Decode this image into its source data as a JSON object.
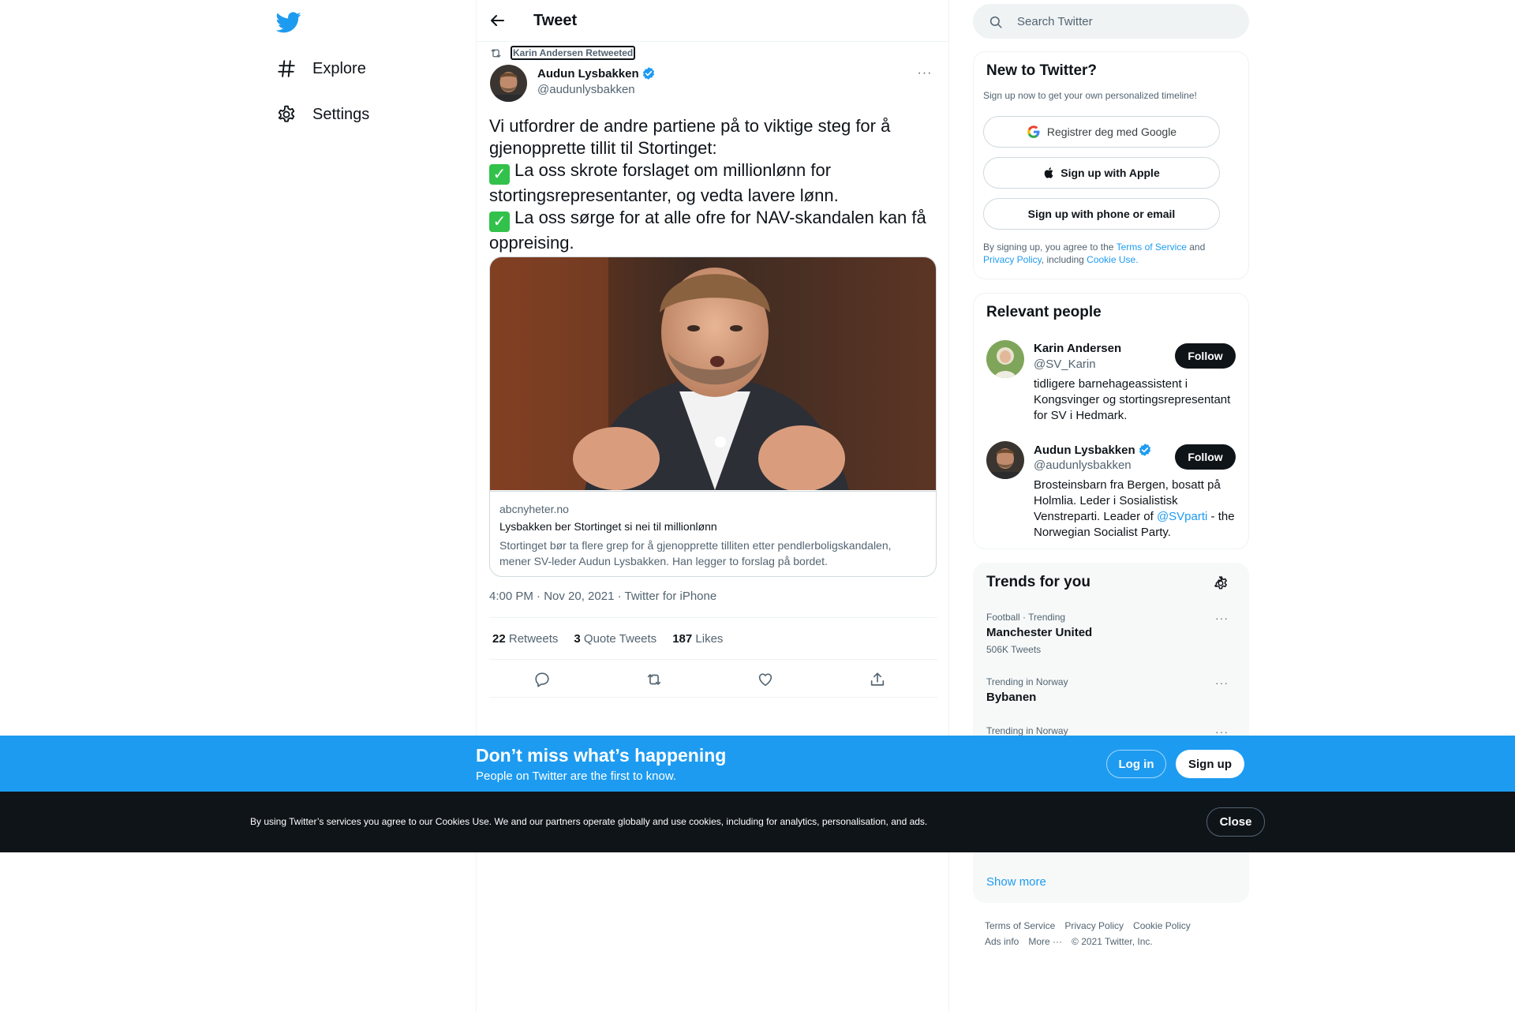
{
  "nav": {
    "logo": "twitter-bird-icon",
    "items": [
      {
        "label": "Explore",
        "icon": "hashtag-icon"
      },
      {
        "label": "Settings",
        "icon": "gear-icon"
      }
    ]
  },
  "header": {
    "title": "Tweet"
  },
  "tweet": {
    "retweeted_by": "Karin Andersen Retweeted",
    "author_name": "Audun Lysbakken",
    "author_handle": "@audunlysbakken",
    "text_line1": "Vi utfordrer de andre partiene på to viktige steg for å gjenopprette tillit til Stortinget:",
    "text_line2": "La oss skrote forslaget om millionlønn for stortingsrepresentanter, og vedta lavere lønn.",
    "text_line3": "La oss sørge for at alle ofre for NAV-skandalen kan få oppreising.",
    "check_glyph": "✓",
    "card": {
      "domain": "abcnyheter.no",
      "title": "Lysbakken ber Stortinget si nei til millionlønn",
      "description": "Stortinget bør ta flere grep for å gjenopprette tilliten etter pendlerboligskandalen, mener SV-leder Audun Lysbakken. Han legger to forslag på bordet."
    },
    "meta": "4:00 PM · Nov 20, 2021 · Twitter for iPhone",
    "stats": {
      "retweets_count": "22",
      "retweets_label": "Retweets",
      "quotes_count": "3",
      "quotes_label": "Quote Tweets",
      "likes_count": "187",
      "likes_label": "Likes"
    }
  },
  "search": {
    "placeholder": "Search Twitter"
  },
  "new_to_twitter": {
    "title": "New to Twitter?",
    "subtitle": "Sign up now to get your own personalized timeline!",
    "google_btn": "Registrer deg med Google",
    "apple_btn": "Sign up with Apple",
    "phone_btn": "Sign up with phone or email",
    "terms_prefix": "By signing up, you agree to the ",
    "terms_link": "Terms of Service",
    "terms_and": " and ",
    "privacy_link": "Privacy Policy",
    "terms_including": ", including ",
    "cookie_link": "Cookie Use."
  },
  "relevant_people": {
    "title": "Relevant people",
    "follow_label": "Follow",
    "people": [
      {
        "name": "Karin Andersen",
        "handle": "@SV_Karin",
        "bio": "tidligere barnehageassistent i Kongsvinger og stortingsrepresentant for SV i Hedmark."
      },
      {
        "name": "Audun Lysbakken",
        "handle": "@audunlysbakken",
        "bio_prefix": "Brosteinsbarn fra Bergen, bosatt på Holmlia. Leder i Sosialistisk Venstreparti. Leader of ",
        "bio_link": "@SVparti",
        "bio_suffix": " - the Norwegian Socialist Party."
      }
    ]
  },
  "trends": {
    "title": "Trends for you",
    "items": [
      {
        "context": "Football · Trending",
        "name": "Manchester United",
        "count": "506K Tweets"
      },
      {
        "context": "Trending in Norway",
        "name": "Bybanen"
      },
      {
        "context": "Trending in Norway"
      }
    ],
    "show_more": "Show more"
  },
  "footer": {
    "links": [
      "Terms of Service",
      "Privacy Policy",
      "Cookie Policy",
      "Ads info",
      "More ···"
    ],
    "copyright": "© 2021 Twitter, Inc."
  },
  "banner": {
    "title": "Don’t miss what’s happening",
    "subtitle": "People on Twitter are the first to know.",
    "login": "Log in",
    "signup": "Sign up"
  },
  "cookie_bar": {
    "text": "By using Twitter’s services you agree to our Cookies Use. We and our partners operate globally and use cookies, including for analytics, personalisation, and ads.",
    "close": "Close"
  },
  "colors": {
    "accent": "#1d9bf0",
    "text": "#0f1419",
    "muted": "#536471",
    "border": "#eff3f4",
    "dark": "#0f1419",
    "check_green": "#32c14a"
  }
}
